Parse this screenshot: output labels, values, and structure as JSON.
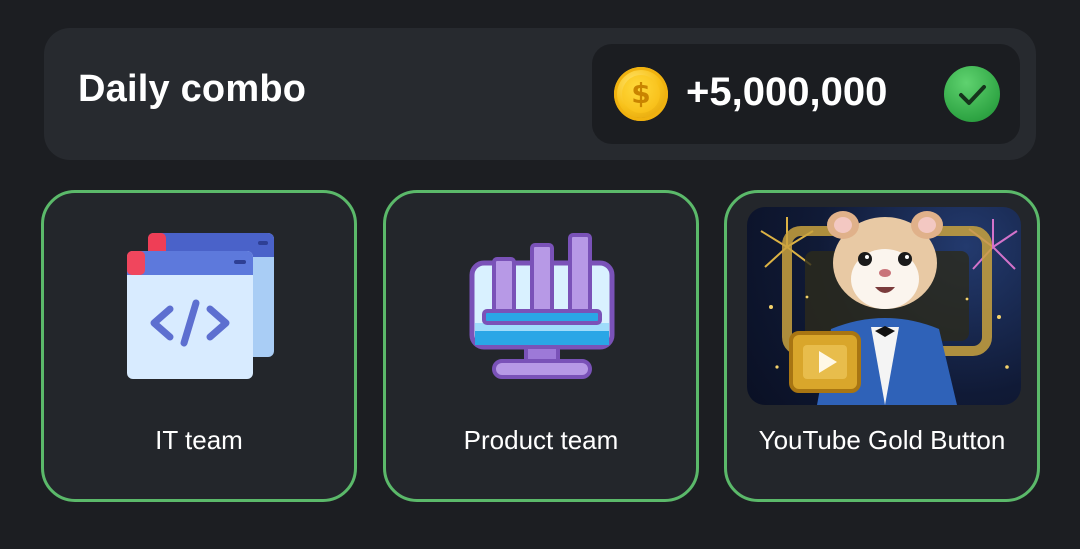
{
  "combo": {
    "title": "Daily combo",
    "reward": "+5,000,000",
    "coin_symbol": "$",
    "claimed": true
  },
  "cards": [
    {
      "label": "IT team",
      "icon": "code-window-icon"
    },
    {
      "label": "Product team",
      "icon": "bar-chart-monitor-icon"
    },
    {
      "label": "YouTube Gold Button",
      "icon": "hamster-gold-button-image"
    }
  ],
  "colors": {
    "background": "#1c1e22",
    "panel": "#272a2f",
    "card": "#23262b",
    "card_border": "#5bb96a",
    "coin": "#f8c21a",
    "check": "#2fa544"
  }
}
